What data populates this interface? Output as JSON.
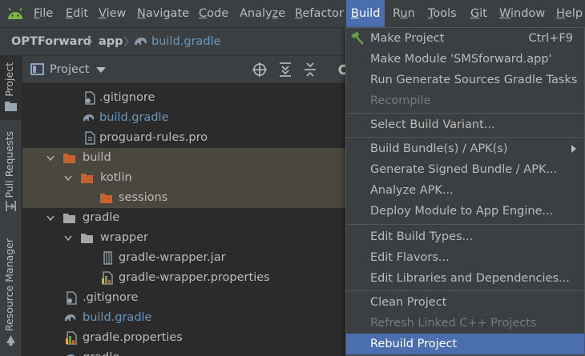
{
  "menubar": {
    "items": [
      {
        "label": "File",
        "mnemonic": "F"
      },
      {
        "label": "Edit",
        "mnemonic": "E"
      },
      {
        "label": "View",
        "mnemonic": "V"
      },
      {
        "label": "Navigate",
        "mnemonic": "N"
      },
      {
        "label": "Code",
        "mnemonic": "C"
      },
      {
        "label": "Analyze",
        "mnemonic": "z"
      },
      {
        "label": "Refactor",
        "mnemonic": "R"
      },
      {
        "label": "Build",
        "mnemonic": "B"
      },
      {
        "label": "Run",
        "mnemonic": "u"
      },
      {
        "label": "Tools",
        "mnemonic": "T"
      },
      {
        "label": "Git",
        "mnemonic": "G"
      },
      {
        "label": "Window",
        "mnemonic": "W"
      },
      {
        "label": "Help",
        "mnemonic": "H"
      }
    ],
    "active": "Build"
  },
  "breadcrumb": {
    "items": [
      "OPTForward",
      "app",
      "build.gradle"
    ]
  },
  "toolstrip": {
    "items": [
      "Project",
      "Pull Requests",
      "Resource Manager"
    ]
  },
  "project_panel": {
    "title": "Project"
  },
  "tree": {
    "rows": [
      {
        "label": ".gitignore",
        "icon": "text-file-icon",
        "style": "normal"
      },
      {
        "label": "build.gradle",
        "icon": "gradle-elephant-icon",
        "style": "gradle"
      },
      {
        "label": "proguard-rules.pro",
        "icon": "text-file-icon",
        "style": "normal"
      },
      {
        "label": "build",
        "icon": "orange-folder-icon",
        "style": "normal"
      },
      {
        "label": "kotlin",
        "icon": "orange-folder-icon",
        "style": "normal"
      },
      {
        "label": "sessions",
        "icon": "orange-folder-icon",
        "style": "normal"
      },
      {
        "label": "gradle",
        "icon": "folder-icon",
        "style": "normal"
      },
      {
        "label": "wrapper",
        "icon": "folder-icon",
        "style": "normal"
      },
      {
        "label": "gradle-wrapper.jar",
        "icon": "jar-icon",
        "style": "normal"
      },
      {
        "label": "gradle-wrapper.properties",
        "icon": "properties-icon",
        "style": "normal"
      },
      {
        "label": ".gitignore",
        "icon": "text-file-icon",
        "style": "normal"
      },
      {
        "label": "build.gradle",
        "icon": "gradle-elephant-icon",
        "style": "gradle"
      },
      {
        "label": "gradle.properties",
        "icon": "properties-icon",
        "style": "normal"
      },
      {
        "label": "gradle...",
        "icon": "gradle-elephant-icon",
        "style": "normal"
      }
    ]
  },
  "build_menu": {
    "items": [
      {
        "label": "Make Project",
        "shortcut": "Ctrl+F9",
        "icon": "hammer-icon"
      },
      {
        "label": "Make Module 'SMSforward.app'"
      },
      {
        "label": "Run Generate Sources Gradle Tasks"
      },
      {
        "label": "Recompile",
        "disabled": true
      },
      {
        "label": "Select Build Variant..."
      },
      {
        "label": "Build Bundle(s) / APK(s)",
        "submenu": true
      },
      {
        "label": "Generate Signed Bundle / APK..."
      },
      {
        "label": "Analyze APK..."
      },
      {
        "label": "Deploy Module to App Engine..."
      },
      {
        "label": "Edit Build Types..."
      },
      {
        "label": "Edit Flavors..."
      },
      {
        "label": "Edit Libraries and Dependencies..."
      },
      {
        "label": "Clean Project"
      },
      {
        "label": "Refresh Linked C++ Projects",
        "disabled": true
      },
      {
        "label": "Rebuild Project",
        "selected": true
      }
    ]
  },
  "colors": {
    "accent": "#4b6eaf",
    "gradle_text": "#6897bb",
    "orange_folder": "#c9622a",
    "folder": "#a5a5a5",
    "highlight_row": "#49473e"
  }
}
